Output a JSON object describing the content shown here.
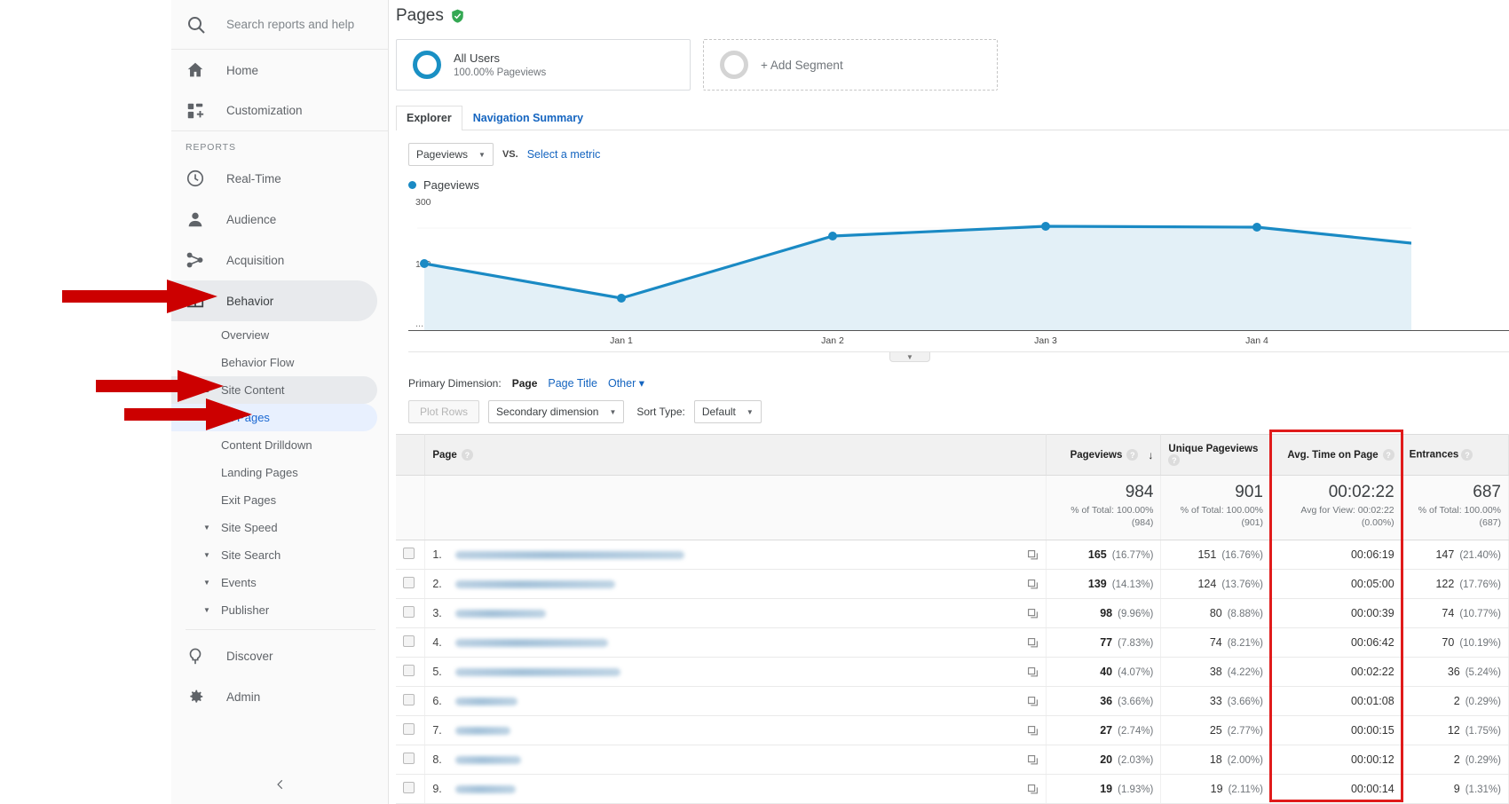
{
  "sidebar": {
    "search": {
      "placeholder": "Search reports and help",
      "icon": "search-icon"
    },
    "top_items": [
      {
        "label": "Home",
        "icon": "home-icon"
      },
      {
        "label": "Customization",
        "icon": "customization-icon"
      }
    ],
    "reports_label": "REPORTS",
    "report_items": [
      {
        "label": "Real-Time",
        "icon": "clock-icon"
      },
      {
        "label": "Audience",
        "icon": "person-icon"
      },
      {
        "label": "Acquisition",
        "icon": "share-icon"
      },
      {
        "label": "Behavior",
        "icon": "behavior-icon",
        "selected": true
      }
    ],
    "behavior_children": [
      {
        "label": "Overview",
        "type": "leaf"
      },
      {
        "label": "Behavior Flow",
        "type": "leaf"
      },
      {
        "label": "Site Content",
        "type": "group",
        "expanded": true,
        "caret": "▲"
      },
      {
        "label": "All Pages",
        "type": "child",
        "current": true
      },
      {
        "label": "Content Drilldown",
        "type": "child"
      },
      {
        "label": "Landing Pages",
        "type": "child"
      },
      {
        "label": "Exit Pages",
        "type": "child"
      },
      {
        "label": "Site Speed",
        "type": "group",
        "caret": "▼"
      },
      {
        "label": "Site Search",
        "type": "group",
        "caret": "▼"
      },
      {
        "label": "Events",
        "type": "group",
        "caret": "▼"
      },
      {
        "label": "Publisher",
        "type": "group",
        "caret": "▼"
      }
    ],
    "discover": {
      "label": "Discover",
      "icon": "bulb-icon"
    },
    "admin": {
      "label": "Admin",
      "icon": "gear-icon"
    },
    "collapse_icon": "chevron-left-icon"
  },
  "header": {
    "title": "Pages",
    "verified_icon": "shield-check-icon"
  },
  "segments": {
    "primary": {
      "name": "All Users",
      "subtitle": "100.00% Pageviews"
    },
    "add": {
      "label": "+ Add Segment"
    }
  },
  "tabs": [
    {
      "label": "Explorer",
      "active": true
    },
    {
      "label": "Navigation Summary",
      "active": false
    }
  ],
  "metric_controls": {
    "metric": "Pageviews",
    "vs": "VS.",
    "select_metric": "Select a metric"
  },
  "chart_legend": {
    "label": "Pageviews"
  },
  "chart_data": {
    "type": "line",
    "title": "Pageviews",
    "xlabel": "",
    "ylabel": "Pageviews",
    "ylim": [
      0,
      300
    ],
    "y_ticks": [
      "300",
      "150"
    ],
    "x_leading_label": "...",
    "categories": [
      "",
      "Jan 1",
      "Jan 2",
      "Jan 3",
      "Jan 4",
      ""
    ],
    "values": [
      150,
      103,
      202,
      216,
      215,
      190
    ],
    "grid": true,
    "legend_position": "top-left",
    "line_color": "#1a8ac4",
    "fill_color": "#e3f0f7"
  },
  "primary_dimension": {
    "label": "Primary Dimension:",
    "options": [
      "Page",
      "Page Title",
      "Other"
    ],
    "current": "Page",
    "other_caret": "▾"
  },
  "table_toolbar": {
    "plot_rows": "Plot Rows",
    "secondary_dimension": "Secondary dimension",
    "sort_type_label": "Sort Type:",
    "sort_type_value": "Default"
  },
  "table": {
    "columns": [
      {
        "key": "checkbox",
        "label": ""
      },
      {
        "key": "page",
        "label": "Page",
        "help": "?"
      },
      {
        "key": "pageviews",
        "label": "Pageviews",
        "help": "?",
        "sorted": true,
        "sort_arrow": "↓"
      },
      {
        "key": "unique_pageviews",
        "label": "Unique Pageviews",
        "help": "?"
      },
      {
        "key": "avg_time",
        "label": "Avg. Time on Page",
        "help": "?",
        "highlighted": true
      },
      {
        "key": "entrances",
        "label": "Entrances",
        "help": "?"
      }
    ],
    "summary": {
      "pageviews": {
        "value": "984",
        "line1": "% of Total: 100.00%",
        "line2": "(984)"
      },
      "unique_pageviews": {
        "value": "901",
        "line1": "% of Total: 100.00%",
        "line2": "(901)"
      },
      "avg_time": {
        "value": "00:02:22",
        "line1": "Avg for View: 00:02:22",
        "line2": "(0.00%)"
      },
      "entrances": {
        "value": "687",
        "line1": "% of Total: 100.00%",
        "line2": "(687)"
      }
    },
    "rows": [
      {
        "num": "1.",
        "page_redacted_width": 258,
        "pageviews": "165",
        "pageviews_pct": "(16.77%)",
        "unique": "151",
        "unique_pct": "(16.76%)",
        "avg_time": "00:06:19",
        "entrances": "147",
        "entrances_pct": "(21.40%)"
      },
      {
        "num": "2.",
        "page_redacted_width": 180,
        "pageviews": "139",
        "pageviews_pct": "(14.13%)",
        "unique": "124",
        "unique_pct": "(13.76%)",
        "avg_time": "00:05:00",
        "entrances": "122",
        "entrances_pct": "(17.76%)"
      },
      {
        "num": "3.",
        "page_redacted_width": 102,
        "pageviews": "98",
        "pageviews_pct": "(9.96%)",
        "unique": "80",
        "unique_pct": "(8.88%)",
        "avg_time": "00:00:39",
        "entrances": "74",
        "entrances_pct": "(10.77%)"
      },
      {
        "num": "4.",
        "page_redacted_width": 172,
        "pageviews": "77",
        "pageviews_pct": "(7.83%)",
        "unique": "74",
        "unique_pct": "(8.21%)",
        "avg_time": "00:06:42",
        "entrances": "70",
        "entrances_pct": "(10.19%)"
      },
      {
        "num": "5.",
        "page_redacted_width": 186,
        "pageviews": "40",
        "pageviews_pct": "(4.07%)",
        "unique": "38",
        "unique_pct": "(4.22%)",
        "avg_time": "00:02:22",
        "entrances": "36",
        "entrances_pct": "(5.24%)"
      },
      {
        "num": "6.",
        "page_redacted_width": 70,
        "pageviews": "36",
        "pageviews_pct": "(3.66%)",
        "unique": "33",
        "unique_pct": "(3.66%)",
        "avg_time": "00:01:08",
        "entrances": "2",
        "entrances_pct": "(0.29%)"
      },
      {
        "num": "7.",
        "page_redacted_width": 62,
        "pageviews": "27",
        "pageviews_pct": "(2.74%)",
        "unique": "25",
        "unique_pct": "(2.77%)",
        "avg_time": "00:00:15",
        "entrances": "12",
        "entrances_pct": "(1.75%)"
      },
      {
        "num": "8.",
        "page_redacted_width": 74,
        "pageviews": "20",
        "pageviews_pct": "(2.03%)",
        "unique": "18",
        "unique_pct": "(2.00%)",
        "avg_time": "00:00:12",
        "entrances": "2",
        "entrances_pct": "(0.29%)"
      },
      {
        "num": "9.",
        "page_redacted_width": 68,
        "pageviews": "19",
        "pageviews_pct": "(1.93%)",
        "unique": "19",
        "unique_pct": "(2.11%)",
        "avg_time": "00:00:14",
        "entrances": "9",
        "entrances_pct": "(1.31%)"
      }
    ]
  },
  "annotations": {
    "highlight_color": "#e01b1b",
    "arrows": [
      {
        "target": "Behavior"
      },
      {
        "target": "Site Content"
      },
      {
        "target": "All Pages"
      }
    ],
    "highlight_box_target": "Avg. Time on Page column"
  }
}
